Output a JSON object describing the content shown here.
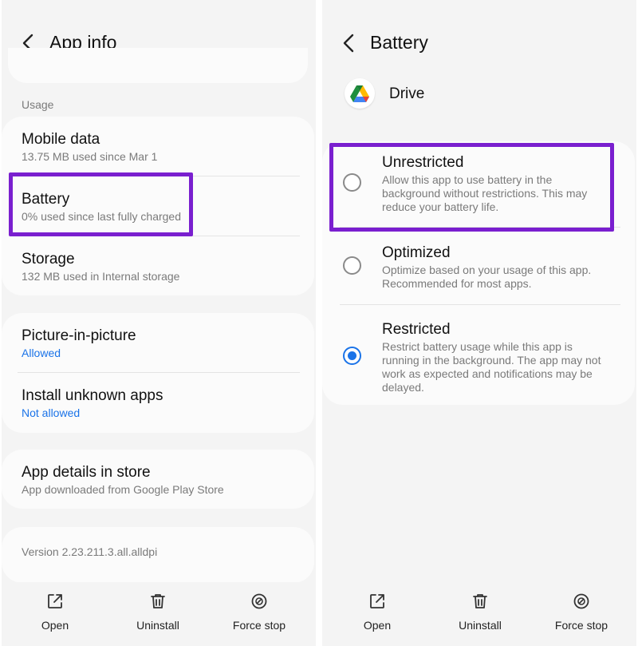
{
  "left": {
    "title": "App info",
    "usage_label": "Usage",
    "mobile_data": {
      "label": "Mobile data",
      "sub": "13.75 MB used since Mar 1"
    },
    "battery": {
      "label": "Battery",
      "sub": "0% used since last fully charged"
    },
    "storage": {
      "label": "Storage",
      "sub": "132 MB used in Internal storage"
    },
    "pip": {
      "label": "Picture-in-picture",
      "sub": "Allowed"
    },
    "unknown_apps": {
      "label": "Install unknown apps",
      "sub": "Not allowed"
    },
    "store": {
      "label": "App details in store",
      "sub": "App downloaded from Google Play Store"
    },
    "version": "Version 2.23.211.3.all.alldpi"
  },
  "right": {
    "title": "Battery",
    "app_name": "Drive",
    "options": [
      {
        "title": "Unrestricted",
        "desc": "Allow this app to use battery in the background without restrictions. This may reduce your battery life.",
        "selected": false
      },
      {
        "title": "Optimized",
        "desc": "Optimize based on your usage of this app. Recommended for most apps.",
        "selected": false
      },
      {
        "title": "Restricted",
        "desc": "Restrict battery usage while this app is running in the background. The app may not work as expected and notifications may be delayed.",
        "selected": true
      }
    ]
  },
  "bottom_bar": {
    "open": "Open",
    "uninstall": "Uninstall",
    "force_stop": "Force stop"
  },
  "colors": {
    "highlight": "#7a1fcf",
    "accent": "#1a73e8",
    "secondary_text": "#7a7a7a"
  },
  "icons": [
    "back-arrow-icon",
    "open-icon",
    "trash-icon",
    "block-icon",
    "google-drive-icon"
  ]
}
